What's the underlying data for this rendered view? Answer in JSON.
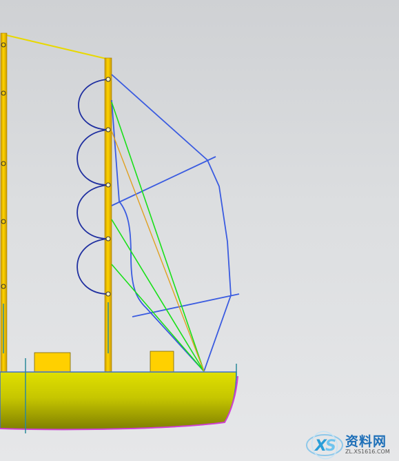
{
  "scene": {
    "colors": {
      "background_top": "#cfd1d4",
      "background_bottom": "#e6e7e9",
      "mast": "#f2c300",
      "mast_edge": "#b08a00",
      "hull_top": "#d8d800",
      "hull_bottom": "#8c8c00",
      "deck_box": "#ffd000",
      "sail_outline": "#3a5be0",
      "sail_loops": "#1f2fa0",
      "green_lines": "#18e018",
      "orange_line": "#e0a020",
      "top_rope": "#e8d800",
      "hull_keel": "#d040d0",
      "axis_marker": "#2a8a9a"
    }
  },
  "watermark": {
    "logo_icon": "xs-logo-icon",
    "title": "资料网",
    "url": "ZL.XS1616.COM"
  }
}
